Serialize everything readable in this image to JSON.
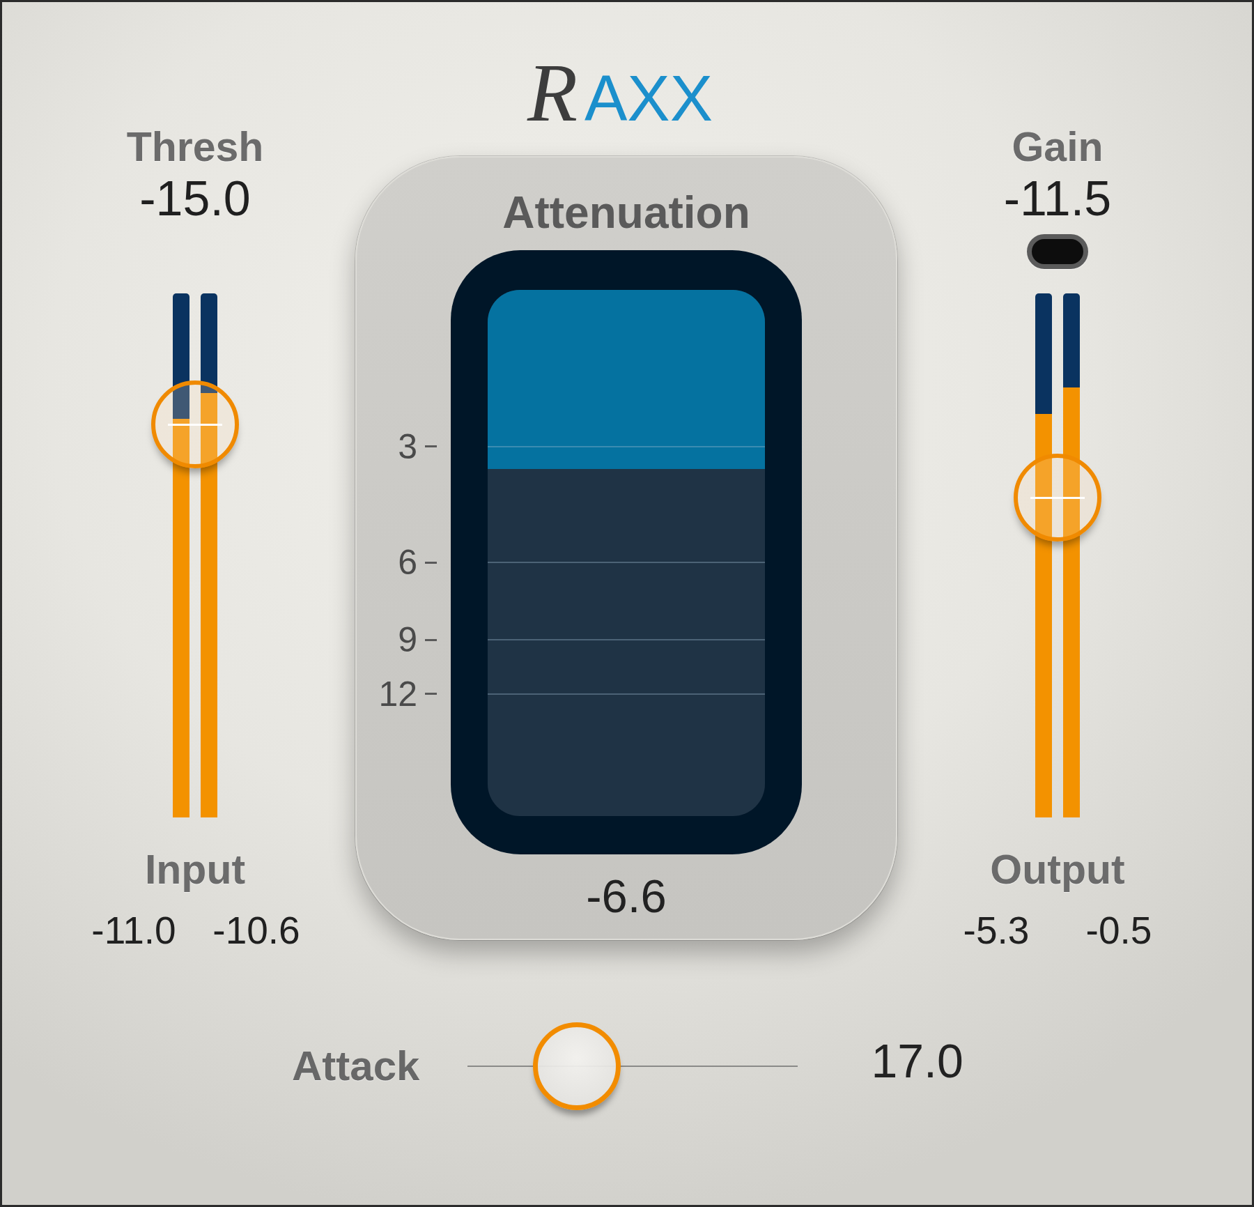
{
  "logo": {
    "letter": "R",
    "wordmark": "AXX"
  },
  "input_strip": {
    "control": {
      "label": "Thresh",
      "value": "-15.0",
      "level": 0.75
    },
    "label": "Input",
    "channels": [
      {
        "level": 0.76,
        "reading": "-11.0"
      },
      {
        "level": 0.81,
        "reading": "-10.6"
      }
    ]
  },
  "attenuation": {
    "label": "Attenuation",
    "scale": [
      "3",
      "6",
      "9",
      "12"
    ],
    "level": 0.34,
    "reading": "-6.6"
  },
  "output_strip": {
    "control": {
      "label": "Gain",
      "value": "-11.5",
      "level": 0.61
    },
    "label": "Output",
    "channels": [
      {
        "level": 0.77,
        "reading": "-5.3"
      },
      {
        "level": 0.82,
        "reading": "-0.5"
      }
    ]
  },
  "attack": {
    "label": "Attack",
    "level": 0.33,
    "value": "17.0"
  }
}
